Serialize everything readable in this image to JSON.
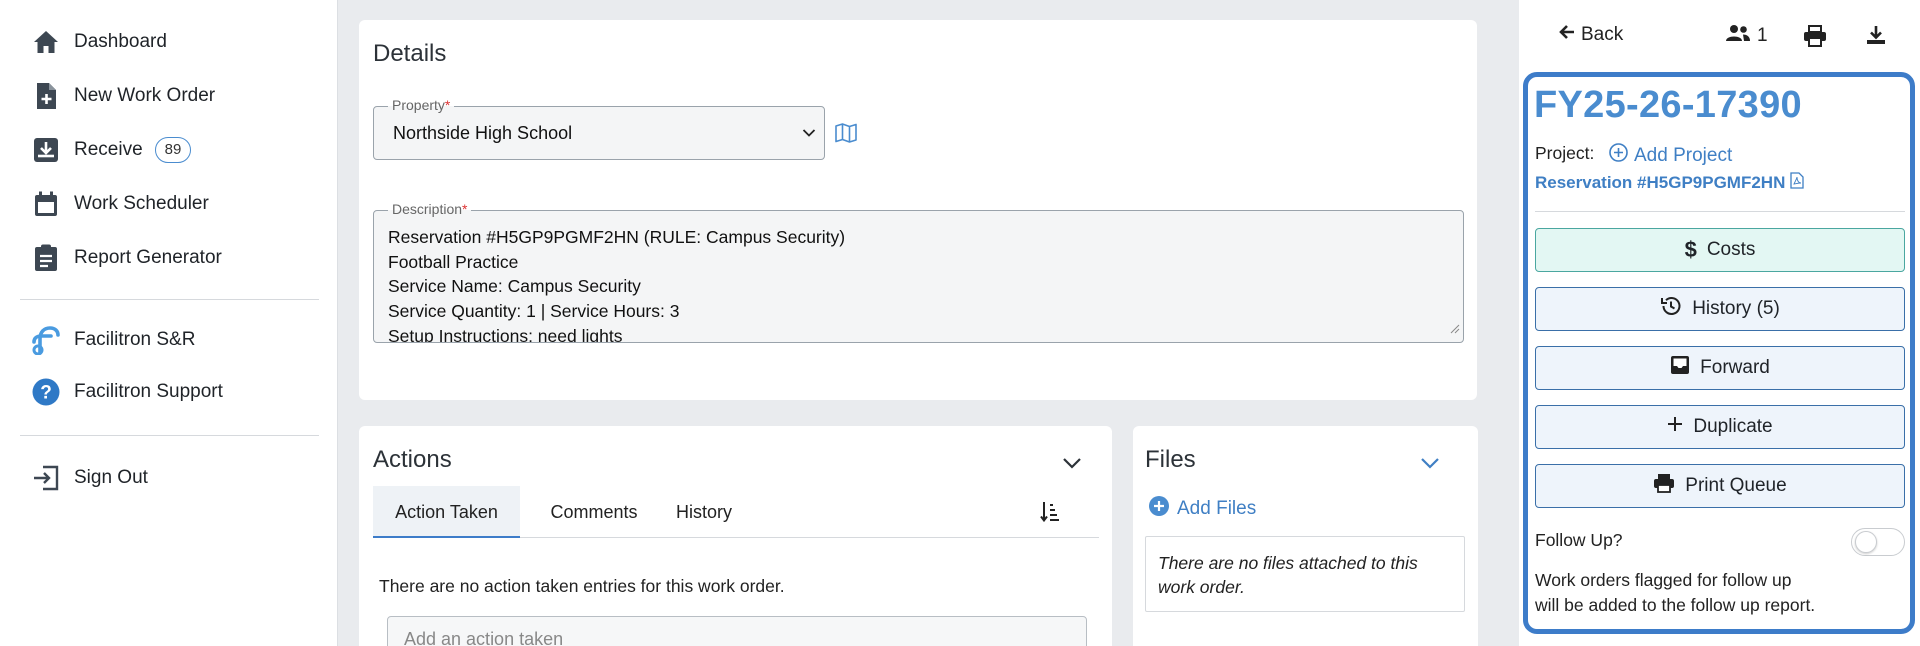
{
  "sidebar": {
    "items": [
      {
        "label": "Dashboard",
        "icon": "home-icon"
      },
      {
        "label": "New Work Order",
        "icon": "file-plus-icon"
      },
      {
        "label": "Receive",
        "icon": "inbox-download-icon",
        "badge": "89"
      },
      {
        "label": "Work Scheduler",
        "icon": "calendar-icon"
      },
      {
        "label": "Report Generator",
        "icon": "clipboard-icon"
      },
      {
        "label": "Facilitron S&R",
        "icon": "facilitron-logo-icon"
      },
      {
        "label": "Facilitron Support",
        "icon": "help-circle-icon"
      },
      {
        "label": "Sign Out",
        "icon": "sign-out-icon"
      }
    ]
  },
  "details": {
    "title": "Details",
    "property": {
      "label": "Property",
      "required_mark": "*",
      "value": "Northside High School"
    },
    "description": {
      "label": "Description",
      "required_mark": "*",
      "lines": [
        "Reservation #H5GP9PGMF2HN (RULE: Campus Security)",
        "Football Practice",
        "Service Name: Campus Security",
        "Service Quantity: 1 | Service Hours: 3",
        "Setup Instructions: need lights"
      ]
    }
  },
  "actions": {
    "title": "Actions",
    "tabs": [
      {
        "label": "Action Taken",
        "active": true
      },
      {
        "label": "Comments",
        "active": false
      },
      {
        "label": "History",
        "active": false
      }
    ],
    "empty_message": "There are no action taken entries for this work order.",
    "input_placeholder": "Add an action taken"
  },
  "files": {
    "title": "Files",
    "add_label": "Add Files",
    "empty_message": "There are no files attached to this work order."
  },
  "right_panel": {
    "back_label": "Back",
    "user_count": "1",
    "work_order_id": "FY25-26-17390",
    "project_label": "Project:",
    "add_project_label": "Add Project",
    "reservation_link": "Reservation #H5GP9PGMF2HN",
    "buttons": {
      "costs": "Costs",
      "history": "History (5)",
      "forward": "Forward",
      "duplicate": "Duplicate",
      "print_queue": "Print Queue"
    },
    "follow_up_label": "Follow Up?",
    "follow_up_on": false,
    "follow_up_note_lines": [
      "Work orders flagged for follow up",
      "will be added to the follow up report."
    ]
  },
  "colors": {
    "accent": "#3d7cc9",
    "link": "#3f7fc4",
    "costs_bg": "#e3f7f3"
  }
}
